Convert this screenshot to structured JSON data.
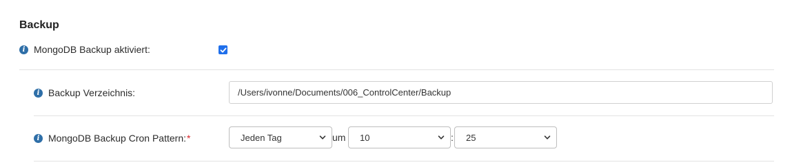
{
  "section": {
    "title": "Backup"
  },
  "backup_enabled": {
    "label": "MongoDB Backup aktiviert:",
    "checked": true
  },
  "backup_dir": {
    "label": "Backup Verzeichnis:",
    "value": "/Users/ivonne/Documents/006_ControlCenter/Backup"
  },
  "cron": {
    "label": "MongoDB Backup Cron Pattern:",
    "required_mark": "*",
    "frequency": "Jeden Tag",
    "at_label": "um",
    "hour": "10",
    "time_sep": ":",
    "minute": "25"
  },
  "icons": {
    "info": "info-icon",
    "checkbox": "check-icon",
    "dropdown": "chevron-down-icon"
  },
  "colors": {
    "accent": "#1f6feb",
    "info": "#2f6fa8",
    "required": "#d9262b"
  }
}
